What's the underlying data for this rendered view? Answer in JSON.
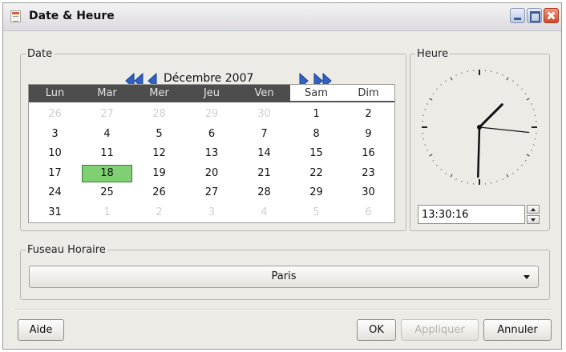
{
  "window": {
    "title": "Date & Heure"
  },
  "date_group": {
    "legend": "Date",
    "month": "Décembre",
    "year": "2007",
    "weekdays": [
      "Lun",
      "Mar",
      "Mer",
      "Jeu",
      "Ven",
      "Sam",
      "Dim"
    ],
    "weeks": [
      [
        {
          "d": "26",
          "dim": true
        },
        {
          "d": "27",
          "dim": true
        },
        {
          "d": "28",
          "dim": true
        },
        {
          "d": "29",
          "dim": true
        },
        {
          "d": "30",
          "dim": true
        },
        {
          "d": "1"
        },
        {
          "d": "2"
        }
      ],
      [
        {
          "d": "3"
        },
        {
          "d": "4"
        },
        {
          "d": "5"
        },
        {
          "d": "6"
        },
        {
          "d": "7"
        },
        {
          "d": "8"
        },
        {
          "d": "9"
        }
      ],
      [
        {
          "d": "10"
        },
        {
          "d": "11"
        },
        {
          "d": "12"
        },
        {
          "d": "13"
        },
        {
          "d": "14"
        },
        {
          "d": "15"
        },
        {
          "d": "16"
        }
      ],
      [
        {
          "d": "17"
        },
        {
          "d": "18",
          "selected": true
        },
        {
          "d": "19"
        },
        {
          "d": "20"
        },
        {
          "d": "21"
        },
        {
          "d": "22"
        },
        {
          "d": "23"
        }
      ],
      [
        {
          "d": "24"
        },
        {
          "d": "25"
        },
        {
          "d": "26"
        },
        {
          "d": "27"
        },
        {
          "d": "28"
        },
        {
          "d": "29"
        },
        {
          "d": "30"
        }
      ],
      [
        {
          "d": "31"
        },
        {
          "d": "1",
          "dim": true
        },
        {
          "d": "2",
          "dim": true
        },
        {
          "d": "3",
          "dim": true
        },
        {
          "d": "4",
          "dim": true
        },
        {
          "d": "5",
          "dim": true
        },
        {
          "d": "6",
          "dim": true
        }
      ]
    ],
    "icons": {
      "prev_year": "double-chevron-left-icon",
      "prev_month": "chevron-left-icon",
      "next_month": "chevron-right-icon",
      "next_year": "double-chevron-right-icon"
    }
  },
  "heure_group": {
    "legend": "Heure",
    "time_value": "13:30:16"
  },
  "timezone_group": {
    "legend": "Fuseau Horaire",
    "selected": "Paris"
  },
  "buttons": {
    "help": "Aide",
    "ok": "OK",
    "apply": "Appliquer",
    "cancel": "Annuler"
  },
  "colors": {
    "accent_blue": "#2f62c6",
    "selected_day": "#7fcf73",
    "header_dark": "#4d4d4d"
  }
}
